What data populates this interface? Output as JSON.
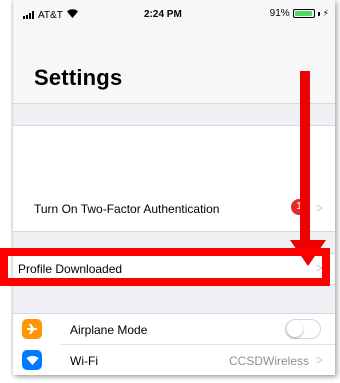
{
  "status_bar": {
    "carrier": "AT&T",
    "time": "2:24 PM",
    "battery_percent": "91%",
    "battery_level": 0.91,
    "signal_icon": "signal-bars-icon",
    "wifi_icon": "wifi-icon",
    "charge_icon": "charging-bolt-icon"
  },
  "header": {
    "title": "Settings"
  },
  "two_factor": {
    "label": "Turn On Two-Factor Authentication",
    "badge": "1"
  },
  "profile": {
    "label": "Profile Downloaded"
  },
  "settings_list": [
    {
      "label": "Airplane Mode",
      "icon": "airplane-icon",
      "icon_color": "#ff9500",
      "control": "toggle",
      "toggle_on": false
    },
    {
      "label": "Wi-Fi",
      "icon": "wifi-icon",
      "icon_color": "#007aff",
      "value": "CCSDWireless"
    }
  ],
  "annotation": {
    "color": "#ff0000",
    "target": "Profile Downloaded"
  }
}
